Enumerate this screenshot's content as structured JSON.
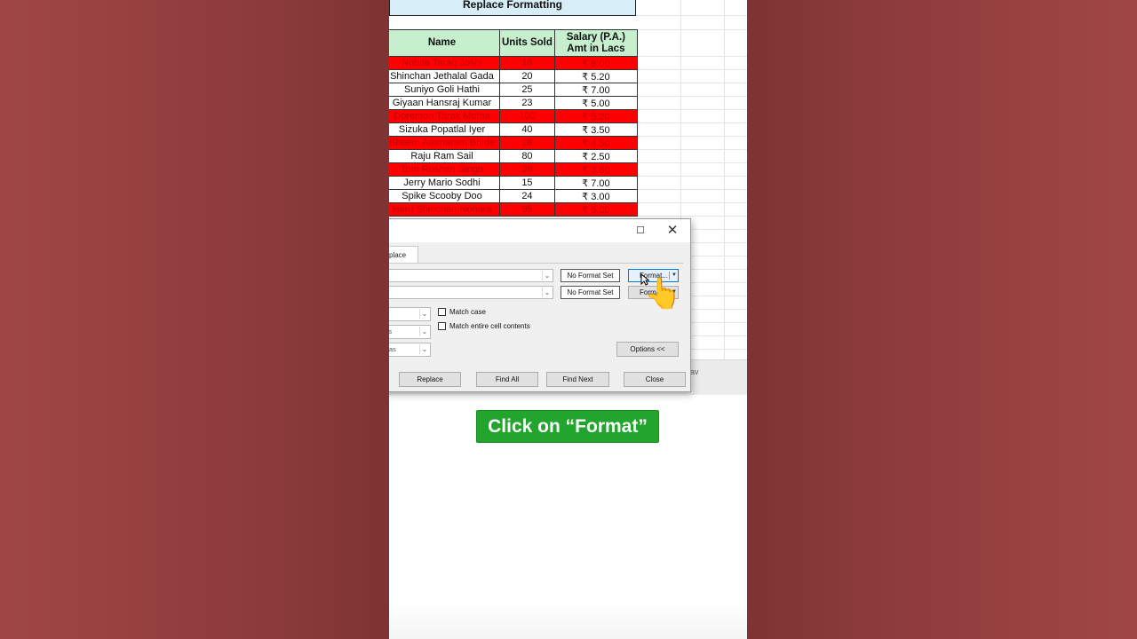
{
  "sheet": {
    "title": "Replace Formatting",
    "headers": [
      "Name",
      "Units Sold",
      "Salary (P.A.)\nAmt in Lacs"
    ],
    "rows": [
      {
        "name": "Nobita Taraq Joshi",
        "units": "18",
        "salary": "₹ 6.00",
        "highlight": true
      },
      {
        "name": "Shinchan Jethalal Gada",
        "units": "20",
        "salary": "₹ 5.20",
        "highlight": false
      },
      {
        "name": "Suniyo Goli Hathi",
        "units": "25",
        "salary": "₹ 7.00",
        "highlight": false
      },
      {
        "name": "Giyaan Hansraj Kumar",
        "units": "23",
        "salary": "₹ 5.00",
        "highlight": false
      },
      {
        "name": "Doremon Tarak Mehta",
        "units": "100",
        "salary": "₹ 5.20",
        "highlight": true
      },
      {
        "name": "Sizuka Popatlal Iyer",
        "units": "40",
        "salary": "₹ 3.50",
        "highlight": false
      },
      {
        "name": "Bheem Aatmaram Bhide",
        "units": "28",
        "salary": "₹ 4.50",
        "highlight": true
      },
      {
        "name": "Raju Ram Sail",
        "units": "80",
        "salary": "₹ 2.50",
        "highlight": false
      },
      {
        "name": "Tom Roshan Singh",
        "units": "28",
        "salary": "₹ 3.60",
        "highlight": true
      },
      {
        "name": "Jerry Mario Sodhi",
        "units": "15",
        "salary": "₹ 7.00",
        "highlight": false
      },
      {
        "name": "Spike Scooby Doo",
        "units": "24",
        "salary": "₹ 3.00",
        "highlight": false
      },
      {
        "name": "Heru Shinchan Nohara",
        "units": "95",
        "salary": "₹ 5.00",
        "highlight": true
      }
    ],
    "highlight_color": "#ff0000",
    "header_color": "#c6efce",
    "title_color": "#d7edf7"
  },
  "dialog": {
    "tab_label": "place",
    "maximize_icon": "☐",
    "close_icon": "✕",
    "format_status_1": "No Format Set",
    "format_status_2": "No Format Set",
    "format_button_1": "Format...",
    "format_button_2": "Format...",
    "within_value": "",
    "search_value": "ws",
    "look_in_value": "ulas",
    "match_case_label": "Match case",
    "match_entire_label": "Match entire cell contents",
    "options_button": "Options <<",
    "replace_button": "Replace",
    "find_all_button": "Find All",
    "find_next_button": "Find Next",
    "close_button": "Close"
  },
  "strip": {
    "right_text": "av"
  },
  "caption": "Click on “Format”",
  "colors": {
    "background": "#8e3d3d",
    "caption_bg": "#22a52c",
    "accent_focus": "#0078d7"
  }
}
